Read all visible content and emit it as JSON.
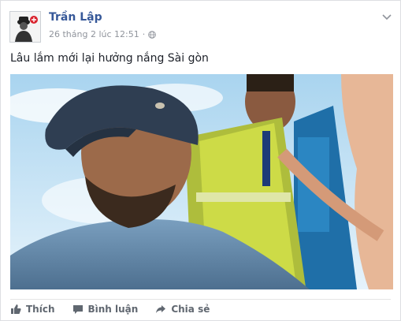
{
  "post": {
    "author": "Trần Lập",
    "timestamp": "26 tháng 2 lúc 12:51",
    "separator": "·",
    "audience_icon": "globe-icon",
    "text": "Lâu lắm mới lại hưởng nắng Sài gòn",
    "menu_icon": "chevron-down-icon"
  },
  "actions": {
    "like_label": "Thích",
    "comment_label": "Bình luận",
    "share_label": "Chia sẻ"
  },
  "colors": {
    "author_link": "#365899",
    "meta_text": "#90949c",
    "action_text": "#606770",
    "accent_brand": "#d9232e"
  }
}
